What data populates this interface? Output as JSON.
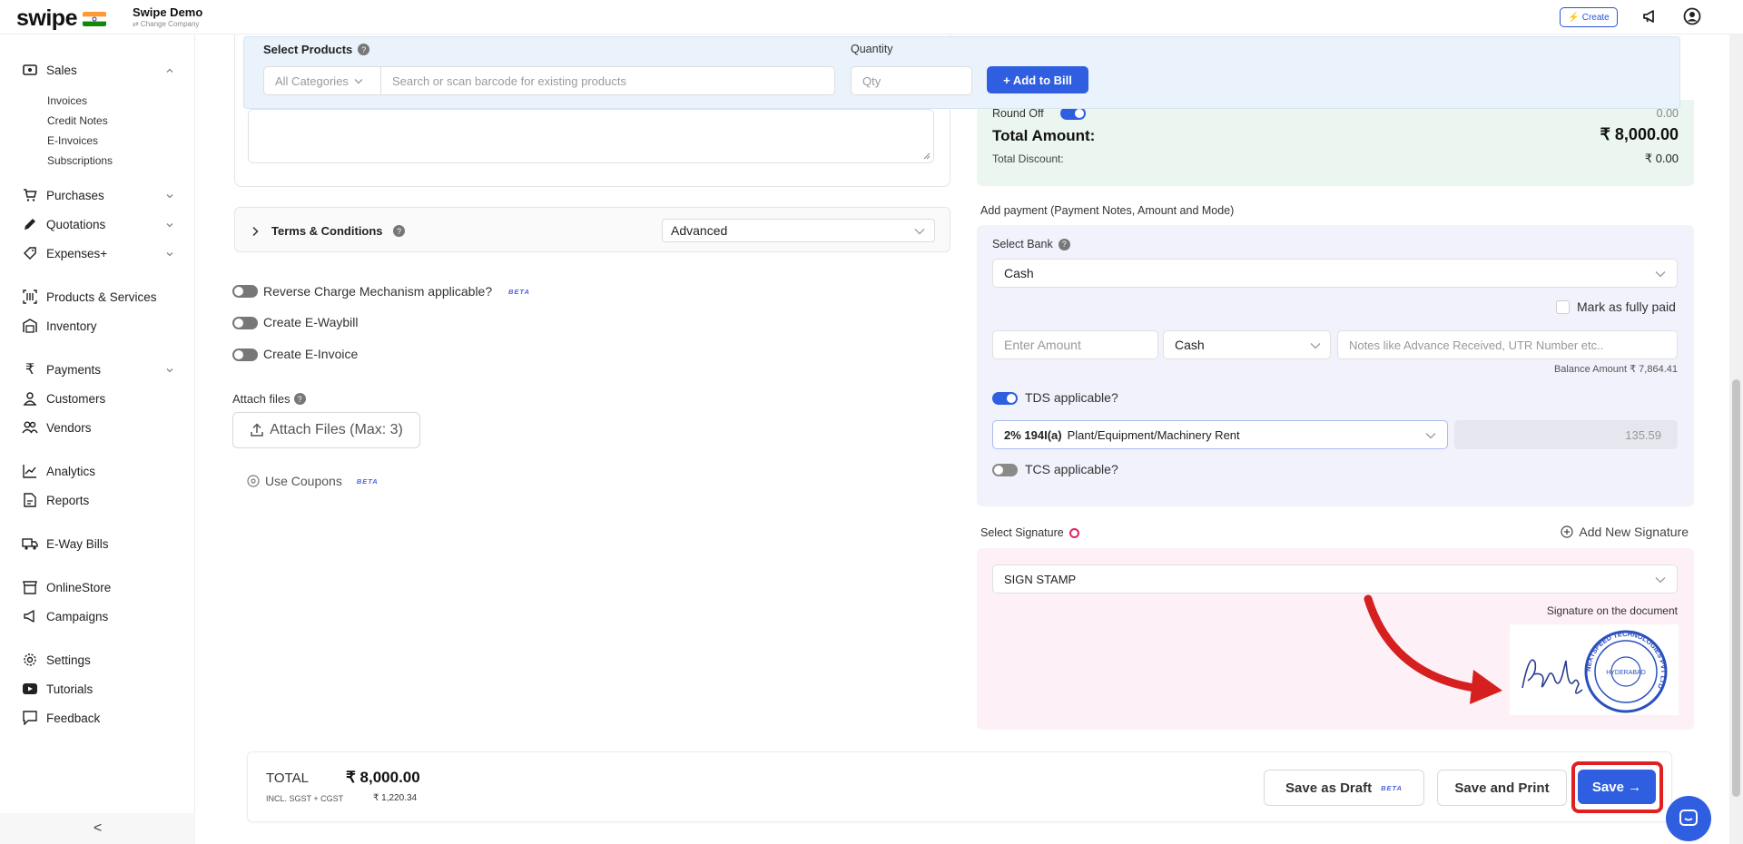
{
  "header": {
    "logo_text": "swipe",
    "company_name": "Swipe Demo",
    "company_sub": "⇄ Change Company",
    "create_label": "Create"
  },
  "sidebar": {
    "sales": "Sales",
    "sales_sub": [
      "Invoices",
      "Credit Notes",
      "E-Invoices",
      "Subscriptions"
    ],
    "purchases": "Purchases",
    "quotations": "Quotations",
    "expenses": "Expenses+",
    "products": "Products & Services",
    "inventory": "Inventory",
    "payments": "Payments",
    "customers": "Customers",
    "vendors": "Vendors",
    "analytics": "Analytics",
    "reports": "Reports",
    "eway": "E-Way Bills",
    "onlinestore": "OnlineStore",
    "campaigns": "Campaigns",
    "settings": "Settings",
    "tutorials": "Tutorials",
    "feedback": "Feedback",
    "collapse": "<"
  },
  "products": {
    "label": "Select Products",
    "category": "All Categories",
    "search_placeholder": "Search or scan barcode for existing products",
    "quantity_label": "Quantity",
    "qty_placeholder": "Qty",
    "add_label": "+ Add to Bill"
  },
  "summary": {
    "round_off_label": "Round Off",
    "round_off_value": "0.00",
    "total_label": "Total Amount:",
    "total_value": "₹ 8,000.00",
    "discount_label": "Total Discount:",
    "discount_value": "₹ 0.00"
  },
  "terms": {
    "label": "Terms & Conditions",
    "select": "Advanced"
  },
  "options": {
    "reverse_charge": "Reverse Charge Mechanism applicable?",
    "beta": "BETA",
    "eway": "Create E-Waybill",
    "einvoice": "Create E-Invoice",
    "attach_label": "Attach files",
    "attach_button": "Attach Files (Max: 3)",
    "coupons": "Use Coupons"
  },
  "payment": {
    "title": "Add payment (Payment Notes, Amount and Mode)",
    "select_bank_label": "Select Bank",
    "bank": "Cash",
    "mark_paid": "Mark as fully paid",
    "amount_placeholder": "Enter Amount",
    "mode": "Cash",
    "notes_placeholder": "Notes like Advance Received, UTR Number etc..",
    "balance": "Balance Amount  ₹ 7,864.41",
    "tds_label": "TDS applicable?",
    "tds_rate": "2% 194I(a)",
    "tds_desc": "Plant/Equipment/Machinery Rent",
    "tds_amount": "135.59",
    "tcs_label": "TCS applicable?"
  },
  "signature": {
    "label": "Select Signature",
    "add_new": "Add New Signature",
    "selected": "SIGN STAMP",
    "doc_label": "Signature on the document",
    "stamp_text_top": "NEXTSPEED TECHNOLOGIES PVT LTD",
    "stamp_center": "HYDERABAD"
  },
  "footer": {
    "total_label": "TOTAL",
    "total_value": "₹ 8,000.00",
    "tax_label": "INCL. SGST + CGST",
    "tax_value": "₹ 1,220.34",
    "draft_label": "Save as Draft",
    "draft_beta": "BETA",
    "print_label": "Save and Print",
    "save_label": "Save →"
  },
  "colors": {
    "primary": "#2f5fe0",
    "highlight": "#e02020"
  }
}
